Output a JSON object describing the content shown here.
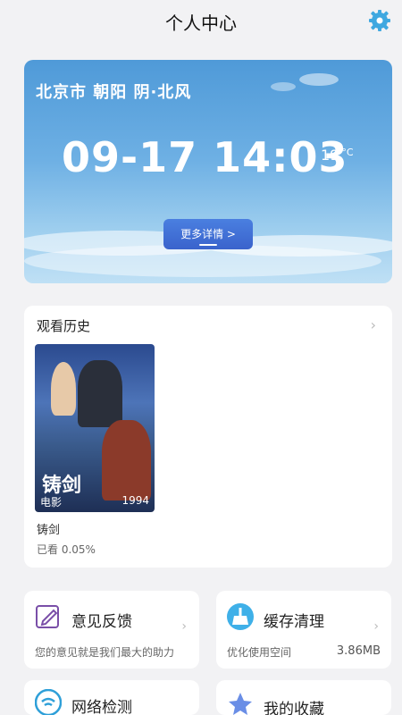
{
  "header": {
    "title": "个人中心"
  },
  "weather": {
    "location": "北京市 朝阳 阴·北风",
    "datetime": "09-17 14:03",
    "temperature": "19",
    "unit": "°C",
    "more_label": "更多详情 >"
  },
  "history": {
    "title": "观看历史",
    "item": {
      "poster_title": "铸剑",
      "poster_label": "电影",
      "poster_year": "1994",
      "name": "铸剑",
      "progress": "已看 0.05%"
    }
  },
  "cards": [
    {
      "title": "意见反馈",
      "desc": "您的意见就是我们最大的助力",
      "value": "",
      "icon": "edit-icon",
      "accent": "#7a4fa8"
    },
    {
      "title": "缓存清理",
      "desc": "优化使用空间",
      "value": "3.86MB",
      "icon": "broom-icon",
      "accent": "#3fb0e8"
    },
    {
      "title": "网络检测",
      "desc": "",
      "value": "",
      "icon": "wifi-icon",
      "accent": "#2e9fd8"
    },
    {
      "title": "我的收藏",
      "desc": "",
      "value": "",
      "icon": "star-icon",
      "accent": "#6a8ee6"
    }
  ],
  "colors": {
    "accent_blue": "#3fa8e0",
    "button_blue": "#3a63cc",
    "background": "#f2f2f4"
  }
}
